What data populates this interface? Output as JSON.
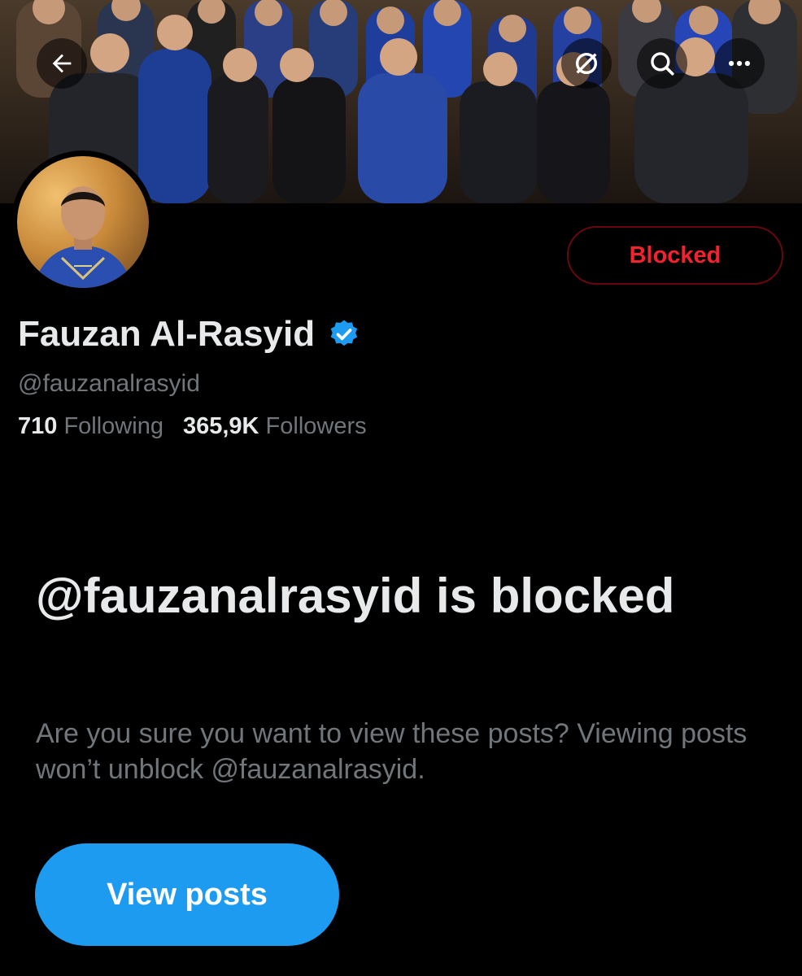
{
  "header": {
    "back_icon": "arrow-left-icon",
    "actions": [
      {
        "icon": "no-signal-icon"
      },
      {
        "icon": "search-icon"
      },
      {
        "icon": "more-horizontal-icon"
      }
    ]
  },
  "profile": {
    "display_name": "Fauzan Al-Rasyid",
    "verified": true,
    "handle": "@fauzanalrasyid",
    "following_count": "710",
    "following_label": "Following",
    "followers_count": "365,9K",
    "followers_label": "Followers",
    "blocked_button_label": "Blocked"
  },
  "blocked_notice": {
    "title": "@fauzanalrasyid is blocked",
    "description": "Are you sure you want to view these posts? Viewing posts won’t unblock @fauzanalrasyid.",
    "button_label": "View posts"
  },
  "colors": {
    "background": "#000000",
    "primary_text": "#e7e9ea",
    "secondary_text": "#71767b",
    "accent_blue": "#1d9bf0",
    "blocked_red": "#f4212e",
    "blocked_border": "#67070f"
  }
}
